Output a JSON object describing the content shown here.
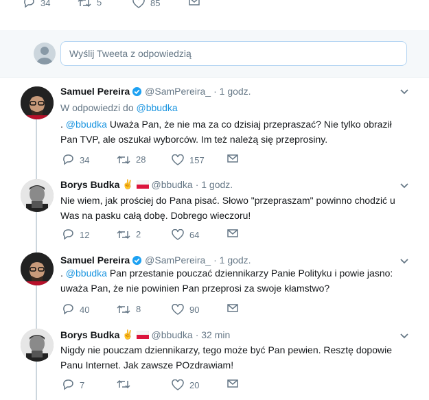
{
  "top_actions": {
    "replies": "34",
    "retweets": "5",
    "likes": "85"
  },
  "reply_box": {
    "placeholder": "Wyślij Tweeta z odpowiedzią"
  },
  "tweets": [
    {
      "name": "Samuel Pereira",
      "handle": "@SamPereira_",
      "time": "· 1 godz.",
      "reply_prefix": "W odpowiedzi do",
      "reply_handle": "@bbudka",
      "text_prefix": ". ",
      "mention": "@bbudka",
      "text": " Uważa Pan, że nie ma za co dzisiaj przepraszać? Nie tylko obraził Pan TVP, ale oszukał wyborców. Im też należą się przeprosiny.",
      "replies": "34",
      "retweets": "28",
      "likes": "157"
    },
    {
      "name": "Borys Budka",
      "emoji": "✌️",
      "handle": "@bbudka",
      "time": "· 1 godz.",
      "text": "Nie wiem, jak prościej do Pana pisać. Słowo \"przepraszam\" powinno chodzić u Was na pasku całą dobę. Dobrego wieczoru!",
      "replies": "12",
      "retweets": "2",
      "likes": "64"
    },
    {
      "name": "Samuel Pereira",
      "handle": "@SamPereira_",
      "time": "· 1 godz.",
      "text_prefix": ". ",
      "mention": "@bbudka",
      "text": " Pan przestanie pouczać dziennikarzy Panie Polityku i powie jasno: uważa Pan, że nie powinien Pan przeprosi za swoje kłamstwo?",
      "replies": "40",
      "retweets": "8",
      "likes": "90"
    },
    {
      "name": "Borys Budka",
      "emoji": "✌️",
      "handle": "@bbudka",
      "time": "· 32 min",
      "text": "Nigdy nie pouczam dziennikarzy, tego może być Pan pewien. Resztę dopowie Panu Internet. Jak zawsze POzdrawiam!",
      "replies": "7",
      "retweets": "",
      "likes": "20"
    }
  ],
  "colors": {
    "link": "#1b95e0",
    "muted": "#657786",
    "verified": "#1da1f2",
    "flag_red": "#dc143c"
  }
}
